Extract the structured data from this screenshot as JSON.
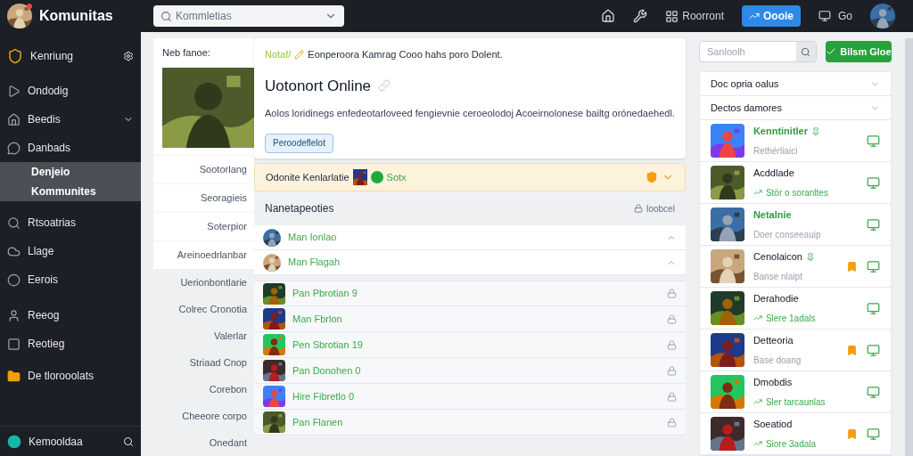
{
  "topbar": {
    "brand": "Komunitas",
    "search": {
      "placeholder": "Kommletias"
    },
    "nav_link": "Roorront",
    "primary_button": "Oooie",
    "screen_link": "Go"
  },
  "sidebar": {
    "header": "Kenriung",
    "items": [
      {
        "label": "Ondodig",
        "selected": false,
        "chevron": false
      },
      {
        "label": "Beedis",
        "selected": false,
        "chevron": true
      },
      {
        "label": "Danbads",
        "selected": false,
        "chevron": false
      },
      {
        "label": "Denjeio",
        "selected": true,
        "chevron": false
      },
      {
        "label": "Kommunites",
        "selected": true,
        "chevron": false
      },
      {
        "label": "Rtsoatrias",
        "selected": false,
        "chevron": false
      },
      {
        "label": "Llage",
        "selected": false,
        "chevron": false
      },
      {
        "label": "Eerois",
        "selected": false,
        "chevron": false
      },
      {
        "label": "Reeog",
        "selected": false,
        "chevron": false
      },
      {
        "label": "Reotieg",
        "selected": false,
        "chevron": false
      },
      {
        "label": "De tlorooolats",
        "selected": false,
        "chevron": false
      }
    ],
    "footer": "Kemooldaa"
  },
  "side_column": {
    "title": "Neb fanoe:",
    "labels": [
      "Sootorlang",
      "Seoragieis",
      "Soterpior",
      "Areinoedrlanbar",
      "Uerionbontlarie",
      "Colrec Cronotia",
      "Valerlar",
      "Striaad Cnop",
      "Corebon",
      "Cheeore corpo",
      "Onedant"
    ]
  },
  "intro": {
    "note_tag": "Notaf/",
    "note": "Eonperoora Kamrag Cooo hahs poro Dolent.",
    "title": "Uotonort Online",
    "description": "Aolos loridinegs enfedeotarloveed fengievnie ceroeolodoj Acoeirnolonese bailtg orónedaehedl.",
    "button": "Peroodeflelot"
  },
  "banner": {
    "text": "Odonite Kenlarlatie",
    "status": "Sotx"
  },
  "friends": {
    "title": "Nanetapeoties",
    "action": "Ioobcel",
    "rows": [
      {
        "kind": "online",
        "name": "Man Ionlao"
      },
      {
        "kind": "online",
        "name": "Man Flagah"
      },
      {
        "kind": "member",
        "name": "Pan Pbrotian 9"
      },
      {
        "kind": "member",
        "name": "Man Fbrlon"
      },
      {
        "kind": "member",
        "name": "Pen Sbrotian 19"
      },
      {
        "kind": "member",
        "name": "Pan Donohen 0"
      },
      {
        "kind": "member",
        "name": "Hire Fibretlo 0"
      },
      {
        "kind": "member",
        "name": "Pan Flanen"
      }
    ]
  },
  "right_panel": {
    "search": {
      "placeholder": "Sanloolh"
    },
    "button": "Bilsm Gloe",
    "filters": [
      "Doc opria oalus",
      "Dectos damores"
    ],
    "games": [
      {
        "name": "Kenntinitler",
        "highlighted": true,
        "pinned": true,
        "subtitle": "Rethérliaici",
        "trending": false,
        "badge": false
      },
      {
        "name": "Acddlade",
        "highlighted": false,
        "pinned": false,
        "subtitle": "Stör o soranltes",
        "trending": true,
        "badge": false
      },
      {
        "name": "Netalnie",
        "highlighted": true,
        "pinned": false,
        "subtitle": "Doer conseeauip",
        "trending": false,
        "badge": false
      },
      {
        "name": "Cenolaicon",
        "highlighted": false,
        "pinned": true,
        "subtitle": "Banse nlaipt",
        "trending": false,
        "badge": true
      },
      {
        "name": "Derahodie",
        "highlighted": false,
        "pinned": false,
        "subtitle": "Slere 1adals",
        "trending": true,
        "badge": false
      },
      {
        "name": "Detteoria",
        "highlighted": false,
        "pinned": false,
        "subtitle": "Base doang",
        "trending": false,
        "badge": true
      },
      {
        "name": "Dmobdis",
        "highlighted": false,
        "pinned": false,
        "subtitle": "Sler tarcaunlas",
        "trending": true,
        "badge": false
      },
      {
        "name": "Soeatiod",
        "highlighted": false,
        "pinned": false,
        "subtitle": "Siore 3adala",
        "trending": true,
        "badge": true
      }
    ]
  }
}
